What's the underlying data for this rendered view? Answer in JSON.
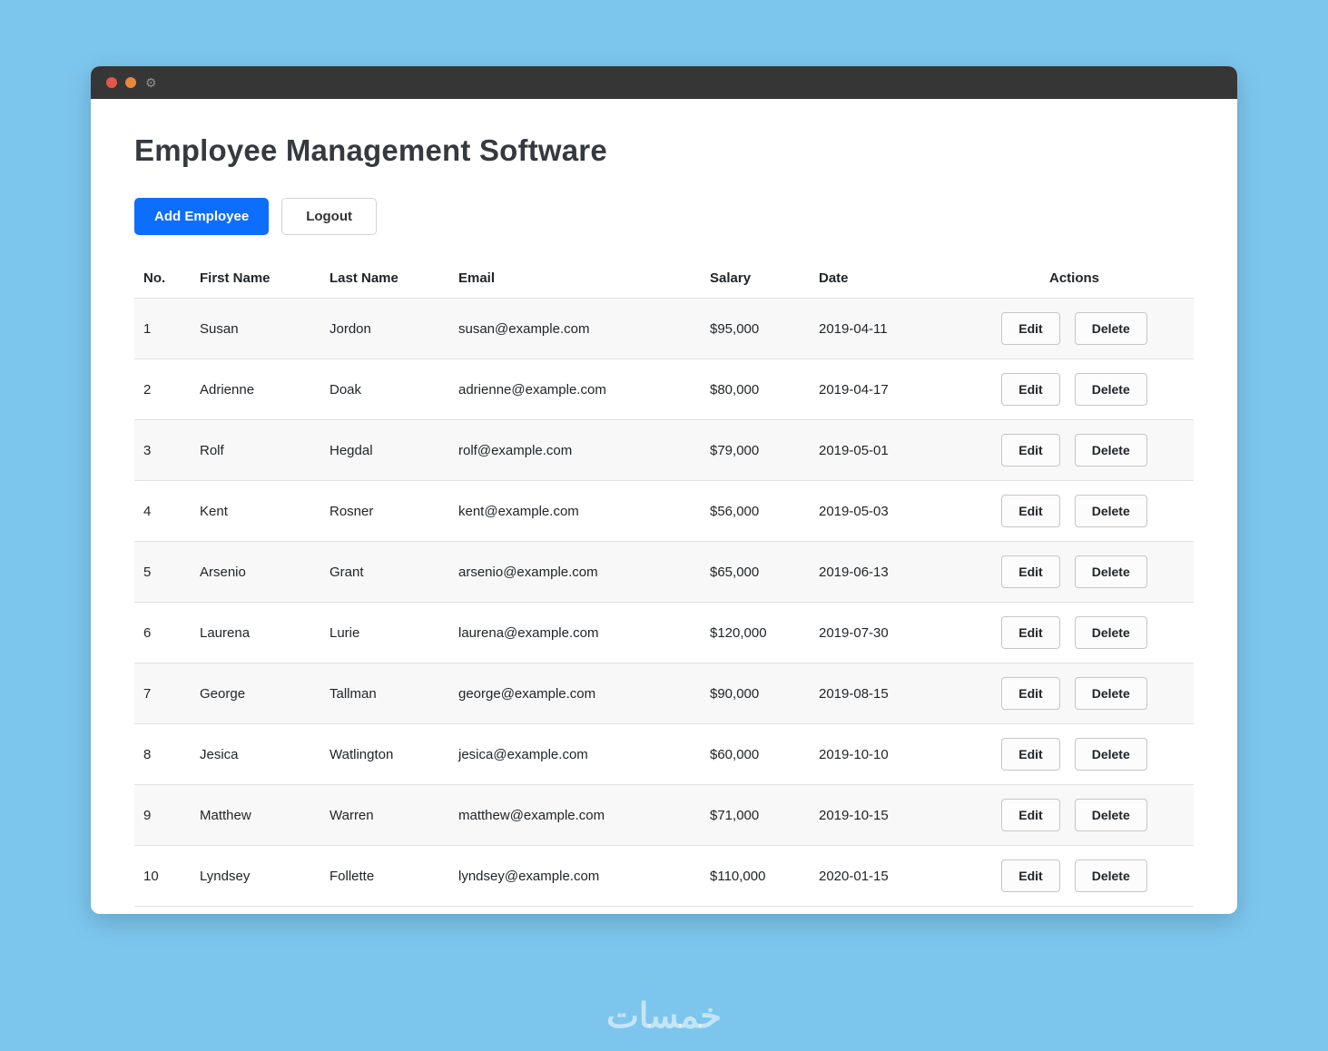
{
  "window": {
    "title": "Employee Management Software"
  },
  "toolbar": {
    "add_label": "Add Employee",
    "logout_label": "Logout"
  },
  "table": {
    "headers": [
      "No.",
      "First Name",
      "Last Name",
      "Email",
      "Salary",
      "Date",
      "Actions"
    ],
    "actions": {
      "edit": "Edit",
      "delete": "Delete"
    },
    "rows": [
      {
        "no": "1",
        "first": "Susan",
        "last": "Jordon",
        "email": "susan@example.com",
        "salary": "$95,000",
        "date": "2019-04-11"
      },
      {
        "no": "2",
        "first": "Adrienne",
        "last": "Doak",
        "email": "adrienne@example.com",
        "salary": "$80,000",
        "date": "2019-04-17"
      },
      {
        "no": "3",
        "first": "Rolf",
        "last": "Hegdal",
        "email": "rolf@example.com",
        "salary": "$79,000",
        "date": "2019-05-01"
      },
      {
        "no": "4",
        "first": "Kent",
        "last": "Rosner",
        "email": "kent@example.com",
        "salary": "$56,000",
        "date": "2019-05-03"
      },
      {
        "no": "5",
        "first": "Arsenio",
        "last": "Grant",
        "email": "arsenio@example.com",
        "salary": "$65,000",
        "date": "2019-06-13"
      },
      {
        "no": "6",
        "first": "Laurena",
        "last": "Lurie",
        "email": "laurena@example.com",
        "salary": "$120,000",
        "date": "2019-07-30"
      },
      {
        "no": "7",
        "first": "George",
        "last": "Tallman",
        "email": "george@example.com",
        "salary": "$90,000",
        "date": "2019-08-15"
      },
      {
        "no": "8",
        "first": "Jesica",
        "last": "Watlington",
        "email": "jesica@example.com",
        "salary": "$60,000",
        "date": "2019-10-10"
      },
      {
        "no": "9",
        "first": "Matthew",
        "last": "Warren",
        "email": "matthew@example.com",
        "salary": "$71,000",
        "date": "2019-10-15"
      },
      {
        "no": "10",
        "first": "Lyndsey",
        "last": "Follette",
        "email": "lyndsey@example.com",
        "salary": "$110,000",
        "date": "2020-01-15"
      }
    ]
  },
  "watermark": {
    "text": "خمسات"
  },
  "colors": {
    "background": "#7cc6ee",
    "titlebar": "#363636",
    "primary_button": "#0d6efd",
    "row_stripe": "#f8f8f8",
    "dot_close": "#e2574c",
    "dot_minimize": "#e6893c"
  }
}
